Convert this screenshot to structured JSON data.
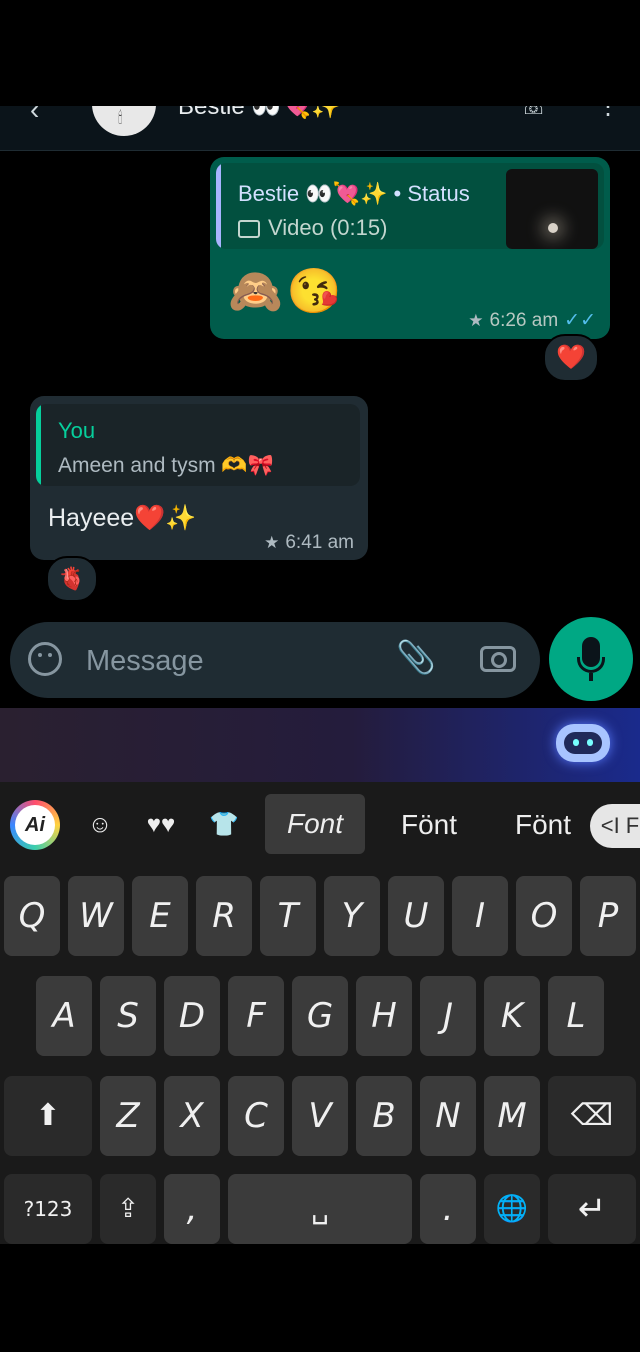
{
  "header": {
    "back": "‹",
    "avatar_glyph": "🕯",
    "name": "Bestie 👀💘✨",
    "call_icon": "phone-icon",
    "menu": "⋮"
  },
  "outgoing": {
    "quote_title": "Bestie 👀💘✨ • Status",
    "quote_sub": "Video (0:15)",
    "emojis": "🙈😘",
    "time": "6:26 am",
    "ticks": "✓✓",
    "reaction": "❤️"
  },
  "incoming": {
    "quote_title": "You",
    "quote_sub": "Ameen and tysm 🫶🎀",
    "text": "Hayeee❤️✨",
    "time": "6:41 am",
    "reaction": "🫀"
  },
  "composer": {
    "placeholder": "Message",
    "attach": "📎"
  },
  "keyboard": {
    "toolbar": {
      "ai_label": "Ai",
      "emoji": "☺",
      "hearts": "♥♥",
      "shirt": "👕",
      "font_active": "Font",
      "font2": "Fönt",
      "font3": "Fönt",
      "more": "<I F"
    },
    "row1": [
      "Q",
      "W",
      "E",
      "R",
      "T",
      "Y",
      "U",
      "I",
      "O",
      "P"
    ],
    "row2": [
      "A",
      "S",
      "D",
      "F",
      "G",
      "H",
      "J",
      "K",
      "L"
    ],
    "row3": [
      "Z",
      "X",
      "C",
      "V",
      "B",
      "N",
      "M"
    ],
    "shift": "⬆",
    "backspace": "⌫",
    "symbols": "?123",
    "share": "⇪",
    "comma": ",",
    "space": "␣",
    "period": ".",
    "globe": "🌐",
    "enter": "↵"
  }
}
